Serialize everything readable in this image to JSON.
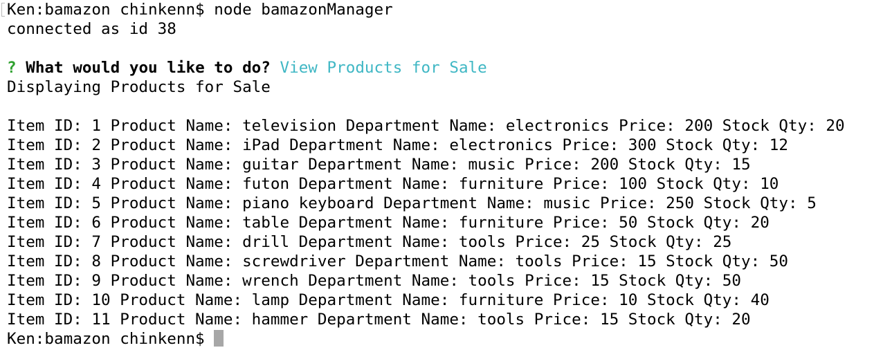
{
  "terminal": {
    "lines": {
      "command": "Ken:bamazon chinkenn$ node bamazonManager",
      "connected": "connected as id 38",
      "prompt_mark": "?",
      "prompt_question": "What would you like to do?",
      "prompt_answer": "View Products for Sale",
      "displaying": "Displaying Products for Sale"
    },
    "rows": [
      "Item ID: 1 Product Name: television Department Name: electronics Price: 200 Stock Qty: 20",
      "Item ID: 2 Product Name: iPad Department Name: electronics Price: 300 Stock Qty: 12",
      "Item ID: 3 Product Name: guitar Department Name: music Price: 200 Stock Qty: 15",
      "Item ID: 4 Product Name: futon Department Name: furniture Price: 100 Stock Qty: 10",
      "Item ID: 5 Product Name: piano keyboard Department Name: music Price: 250 Stock Qty: 5",
      "Item ID: 6 Product Name: table Department Name: furniture Price: 50 Stock Qty: 20",
      "Item ID: 7 Product Name: drill Department Name: tools Price: 25 Stock Qty: 25",
      "Item ID: 8 Product Name: screwdriver Department Name: tools Price: 15 Stock Qty: 50",
      "Item ID: 9 Product Name: wrench Department Name: tools Price: 15 Stock Qty: 50",
      "Item ID: 10 Product Name: lamp Department Name: furniture Price: 10 Stock Qty: 40",
      "Item ID: 11 Product Name: hammer Department Name: tools Price: 15 Stock Qty: 20"
    ],
    "final_prompt": "Ken:bamazon chinkenn$ ",
    "colors": {
      "background": "#ffffff",
      "text": "#000000",
      "prompt_mark": "#2fa12f",
      "answer": "#3fb7c4",
      "cursor": "#a7a7a7"
    }
  }
}
